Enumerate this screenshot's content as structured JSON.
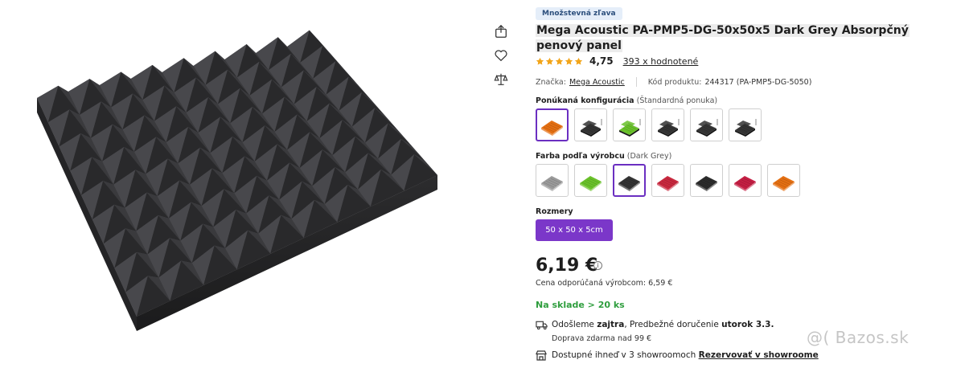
{
  "badge": "Množstevná zľava",
  "title": "Mega Acoustic PA-PMP5-DG-50x50x5 Dark Grey Absorpčný penový panel",
  "rating": {
    "value": "4,75",
    "stars": 5,
    "count_label": "393 x hodnotené"
  },
  "meta": {
    "brand_label": "Značka:",
    "brand_value": "Mega Acoustic",
    "code_label": "Kód produktu:",
    "code_value": "244317 (PA-PMP5-DG-5050)"
  },
  "configuration": {
    "label": "Ponúkaná konfigurácia",
    "note": "(Štandardná ponuka)",
    "options": [
      {
        "icon": "orange-panel",
        "color": "#e46f12"
      },
      {
        "icon": "dark-grey-panel-set",
        "color": "#333333"
      },
      {
        "icon": "green-panel-set",
        "color": "#69c12a"
      },
      {
        "icon": "dark-grey-panel-set",
        "color": "#333333"
      },
      {
        "icon": "dark-grey-panel-set",
        "color": "#333333"
      },
      {
        "icon": "dark-grey-panel-set",
        "color": "#333333"
      }
    ]
  },
  "color": {
    "label": "Farba podľa výrobcu",
    "note": "(Dark Grey)",
    "options": [
      {
        "name": "light-grey-panel",
        "color": "#9a9a9a"
      },
      {
        "name": "green-panel",
        "color": "#69c12a"
      },
      {
        "name": "dark-grey-panel",
        "color": "#333333"
      },
      {
        "name": "red-panel",
        "color": "#c8283e"
      },
      {
        "name": "black-panel",
        "color": "#2b2b2b"
      },
      {
        "name": "crimson-panel",
        "color": "#c41e43"
      },
      {
        "name": "orange-panel",
        "color": "#e46f12"
      }
    ]
  },
  "size": {
    "label": "Rozmery",
    "value": "50 x 50 x 5cm"
  },
  "price": {
    "value": "6,19 €",
    "info_icon": "i",
    "rrp": "Cena odporúčaná výrobcom: 6,59 €"
  },
  "stock": "Na sklade > 20 ks",
  "shipping": {
    "prefix": "Odošleme",
    "day": "zajtra",
    "middle": ", Predbežné doručenie",
    "date": "utorok 3.3.",
    "free": "Doprava zdarma nad 99 €"
  },
  "showroom": {
    "text": "Dostupné ihneď v 3 showroomoch",
    "link": "Rezervovať v showroome"
  },
  "watermark": "@( Bazos.sk",
  "colors": {
    "accent": "#7b37c9",
    "stock_green": "#2f9e3e",
    "star": "#f2a51a",
    "foam": "#3d3d3f"
  }
}
